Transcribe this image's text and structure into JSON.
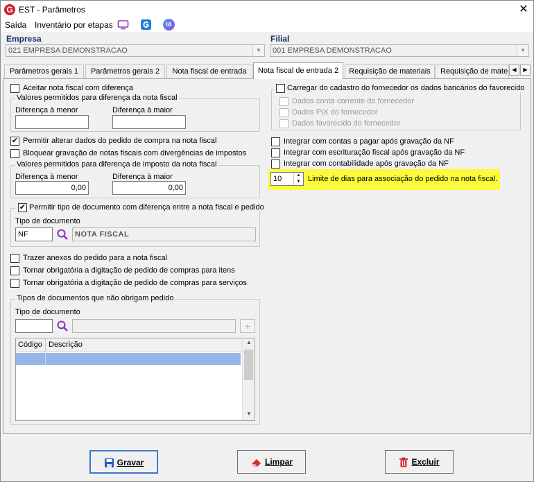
{
  "window": {
    "title": "EST - Parâmetros",
    "close": "✕"
  },
  "menu": {
    "items": [
      "Saída",
      "Inventário por etapas"
    ],
    "ia_label": "IA"
  },
  "empresa": {
    "label": "Empresa",
    "value": "021 EMPRESA DEMONSTRACAO"
  },
  "filial": {
    "label": "Filial",
    "value": "001 EMPRESA DEMONSTRACAO"
  },
  "tabs": [
    {
      "label": "Parâmetros gerais 1"
    },
    {
      "label": "Parâmetros gerais 2"
    },
    {
      "label": "Nota fiscal de entrada"
    },
    {
      "label": "Nota fiscal de entrada 2"
    },
    {
      "label": "Requisição de materiais"
    },
    {
      "label": "Requisição de materi"
    }
  ],
  "left": {
    "aceitar_nf": {
      "label": "Aceitar nota fiscal com diferença",
      "checked": false
    },
    "grp_valores": {
      "title": "Valores permitidos para diferença da nota fiscal",
      "menor_label": "Diferença à menor",
      "menor_value": "",
      "maior_label": "Diferença à maior",
      "maior_value": ""
    },
    "permitir_alterar": {
      "label": "Permitir alterar dados do pedido de compra na nota fiscal",
      "checked": true
    },
    "bloquear": {
      "label": "Bloquear gravação de notas fiscais com divergências de impostos",
      "checked": false
    },
    "grp_imposto": {
      "title": "Valores permitidos para diferença de imposto da nota fiscal",
      "menor_label": "Diferença à menor",
      "menor_value": "0,00",
      "maior_label": "Diferença à maior",
      "maior_value": "0,00"
    },
    "grp_tipo": {
      "title": "Permitir tipo de documento com diferença entre a nota fiscal e pedido",
      "checked": true,
      "tipo_label": "Tipo de documento",
      "tipo_code": "NF",
      "tipo_desc": "NOTA FISCAL"
    },
    "trazer_anexos": {
      "label": "Trazer anexos do pedido para a nota fiscal",
      "checked": false
    },
    "obrig_itens": {
      "label": "Tornar obrigatória a digitação de pedido de compras para itens",
      "checked": false
    },
    "obrig_servicos": {
      "label": "Tornar obrigatória a digitação de pedido de compras para serviços",
      "checked": false
    },
    "grp_tipos_nao_obrigam": {
      "title": "Tipos de documentos que não obrigam pedido",
      "tipo_label": "Tipo de documento",
      "tipo_code": "",
      "add": "+",
      "columns": [
        "Código",
        "Descrição"
      ]
    }
  },
  "right": {
    "carregar": {
      "label": "Carregar do cadastro do fornecedor os dados bancários do favorecido",
      "checked": false,
      "sub": [
        {
          "label": "Dados conta corrente do fornecedor"
        },
        {
          "label": "Dados PIX do fornecedor"
        },
        {
          "label": "Dados favorecido do fornecedor"
        }
      ]
    },
    "integrar_pagar": {
      "label": "Integrar com contas a pagar após gravação da NF",
      "checked": false
    },
    "integrar_fiscal": {
      "label": "Integrar com escrituração fiscal após gravação da NF",
      "checked": false
    },
    "integrar_contab": {
      "label": "Integrar com contabilidade após gravação da NF",
      "checked": false
    },
    "limite": {
      "value": "10",
      "label": "Limite de dias para associação do pedido na nota fiscal."
    }
  },
  "buttons": {
    "gravar": "Gravar",
    "limpar": "Limpar",
    "excluir": "Excluir"
  },
  "colors": {
    "highlight": "#fbfb3c",
    "accent": "#1a2f6e",
    "selection": "#97b5e8"
  }
}
